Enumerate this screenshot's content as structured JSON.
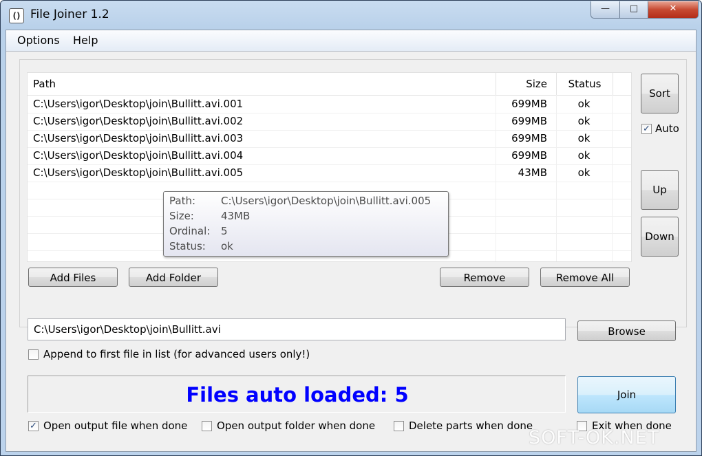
{
  "window": {
    "title": "File Joiner 1.2",
    "icon_label": "()",
    "minimize_glyph": "—",
    "maximize_glyph": "□",
    "close_glyph": "✕"
  },
  "menu": {
    "items": [
      {
        "label": "Options"
      },
      {
        "label": "Help"
      }
    ]
  },
  "file_list": {
    "headers": {
      "path": "Path",
      "size": "Size",
      "status": "Status"
    },
    "rows": [
      {
        "path": "C:\\Users\\igor\\Desktop\\join\\Bullitt.avi.001",
        "size": "699MB",
        "status": "ok"
      },
      {
        "path": "C:\\Users\\igor\\Desktop\\join\\Bullitt.avi.002",
        "size": "699MB",
        "status": "ok"
      },
      {
        "path": "C:\\Users\\igor\\Desktop\\join\\Bullitt.avi.003",
        "size": "699MB",
        "status": "ok"
      },
      {
        "path": "C:\\Users\\igor\\Desktop\\join\\Bullitt.avi.004",
        "size": "699MB",
        "status": "ok"
      },
      {
        "path": "C:\\Users\\igor\\Desktop\\join\\Bullitt.avi.005",
        "size": "43MB",
        "status": "ok"
      }
    ]
  },
  "tooltip": {
    "path_label": "Path:",
    "path_value": "C:\\Users\\igor\\Desktop\\join\\Bullitt.avi.005",
    "size_label": "Size:",
    "size_value": "43MB",
    "ordinal_label": "Ordinal:",
    "ordinal_value": "5",
    "status_label": "Status:",
    "status_value": "ok"
  },
  "buttons": {
    "sort": "Sort",
    "up": "Up",
    "down": "Down",
    "add_files": "Add Files",
    "add_folder": "Add Folder",
    "remove": "Remove",
    "remove_all": "Remove All",
    "browse": "Browse",
    "join": "Join"
  },
  "auto_checkbox": {
    "label": "Auto",
    "checked": true
  },
  "output": {
    "path": "C:\\Users\\igor\\Desktop\\join\\Bullitt.avi",
    "append_label": "Append to first file in list (for advanced users only!)",
    "append_checked": false
  },
  "status": {
    "text": "Files auto loaded: 5",
    "color": "#0000ff"
  },
  "options": [
    {
      "label": "Open output file when done",
      "checked": true
    },
    {
      "label": "Open output folder when done",
      "checked": false
    },
    {
      "label": "Delete parts when done",
      "checked": false
    },
    {
      "label": "Exit when done",
      "checked": false
    }
  ],
  "watermark": "SOFT-OK.NET",
  "check_glyph": "✓"
}
